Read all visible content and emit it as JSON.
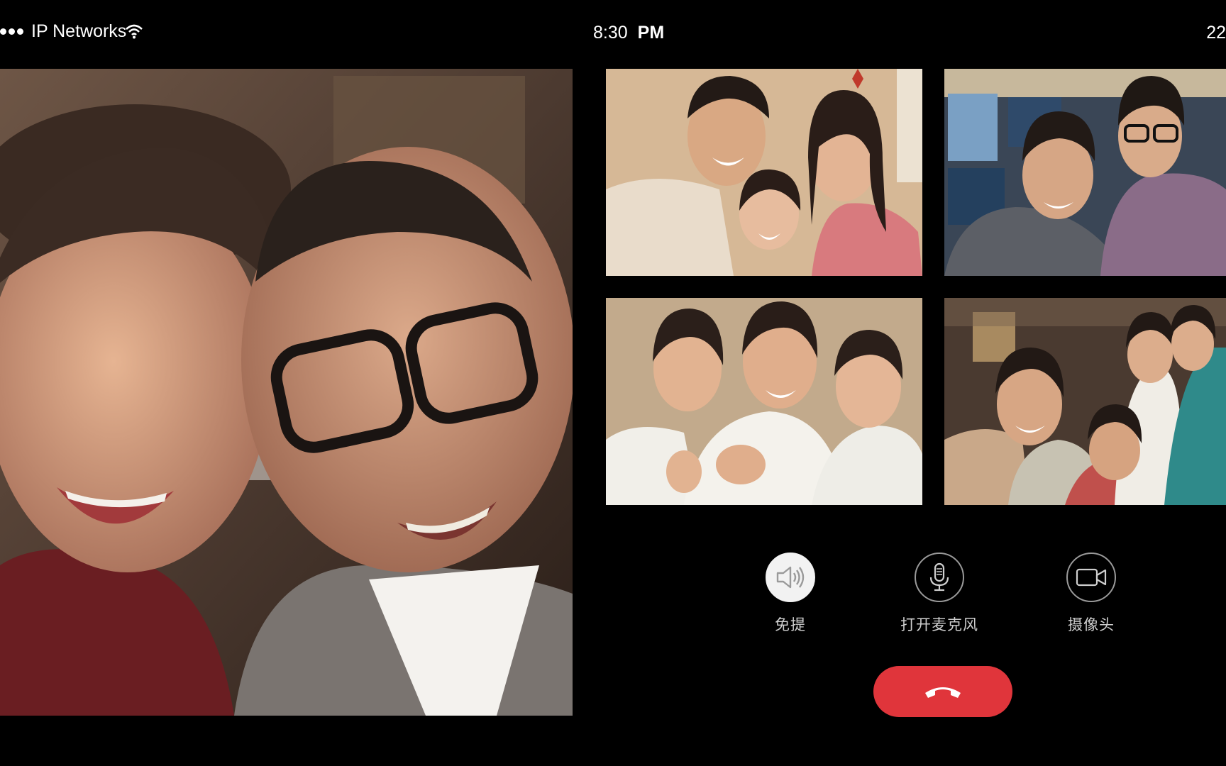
{
  "status_bar": {
    "carrier": "IP Networks",
    "time": "8:30",
    "ampm": "PM",
    "battery": "22"
  },
  "participants": {
    "main": {
      "icon": "elderly-couple-video-feed"
    },
    "tiles": [
      {
        "icon": "family-video-feed"
      },
      {
        "icon": "coworkers-video-feed"
      },
      {
        "icon": "doctors-video-feed"
      },
      {
        "icon": "friends-video-feed"
      }
    ]
  },
  "controls": {
    "speaker_label": "免提",
    "mic_label": "打开麦克风",
    "camera_label": "摄像头",
    "speaker_active": true,
    "hangup_color": "#e0353b"
  },
  "colors": {
    "background": "#000000",
    "hangup": "#e0353b",
    "active_button": "#f2f2f2"
  }
}
